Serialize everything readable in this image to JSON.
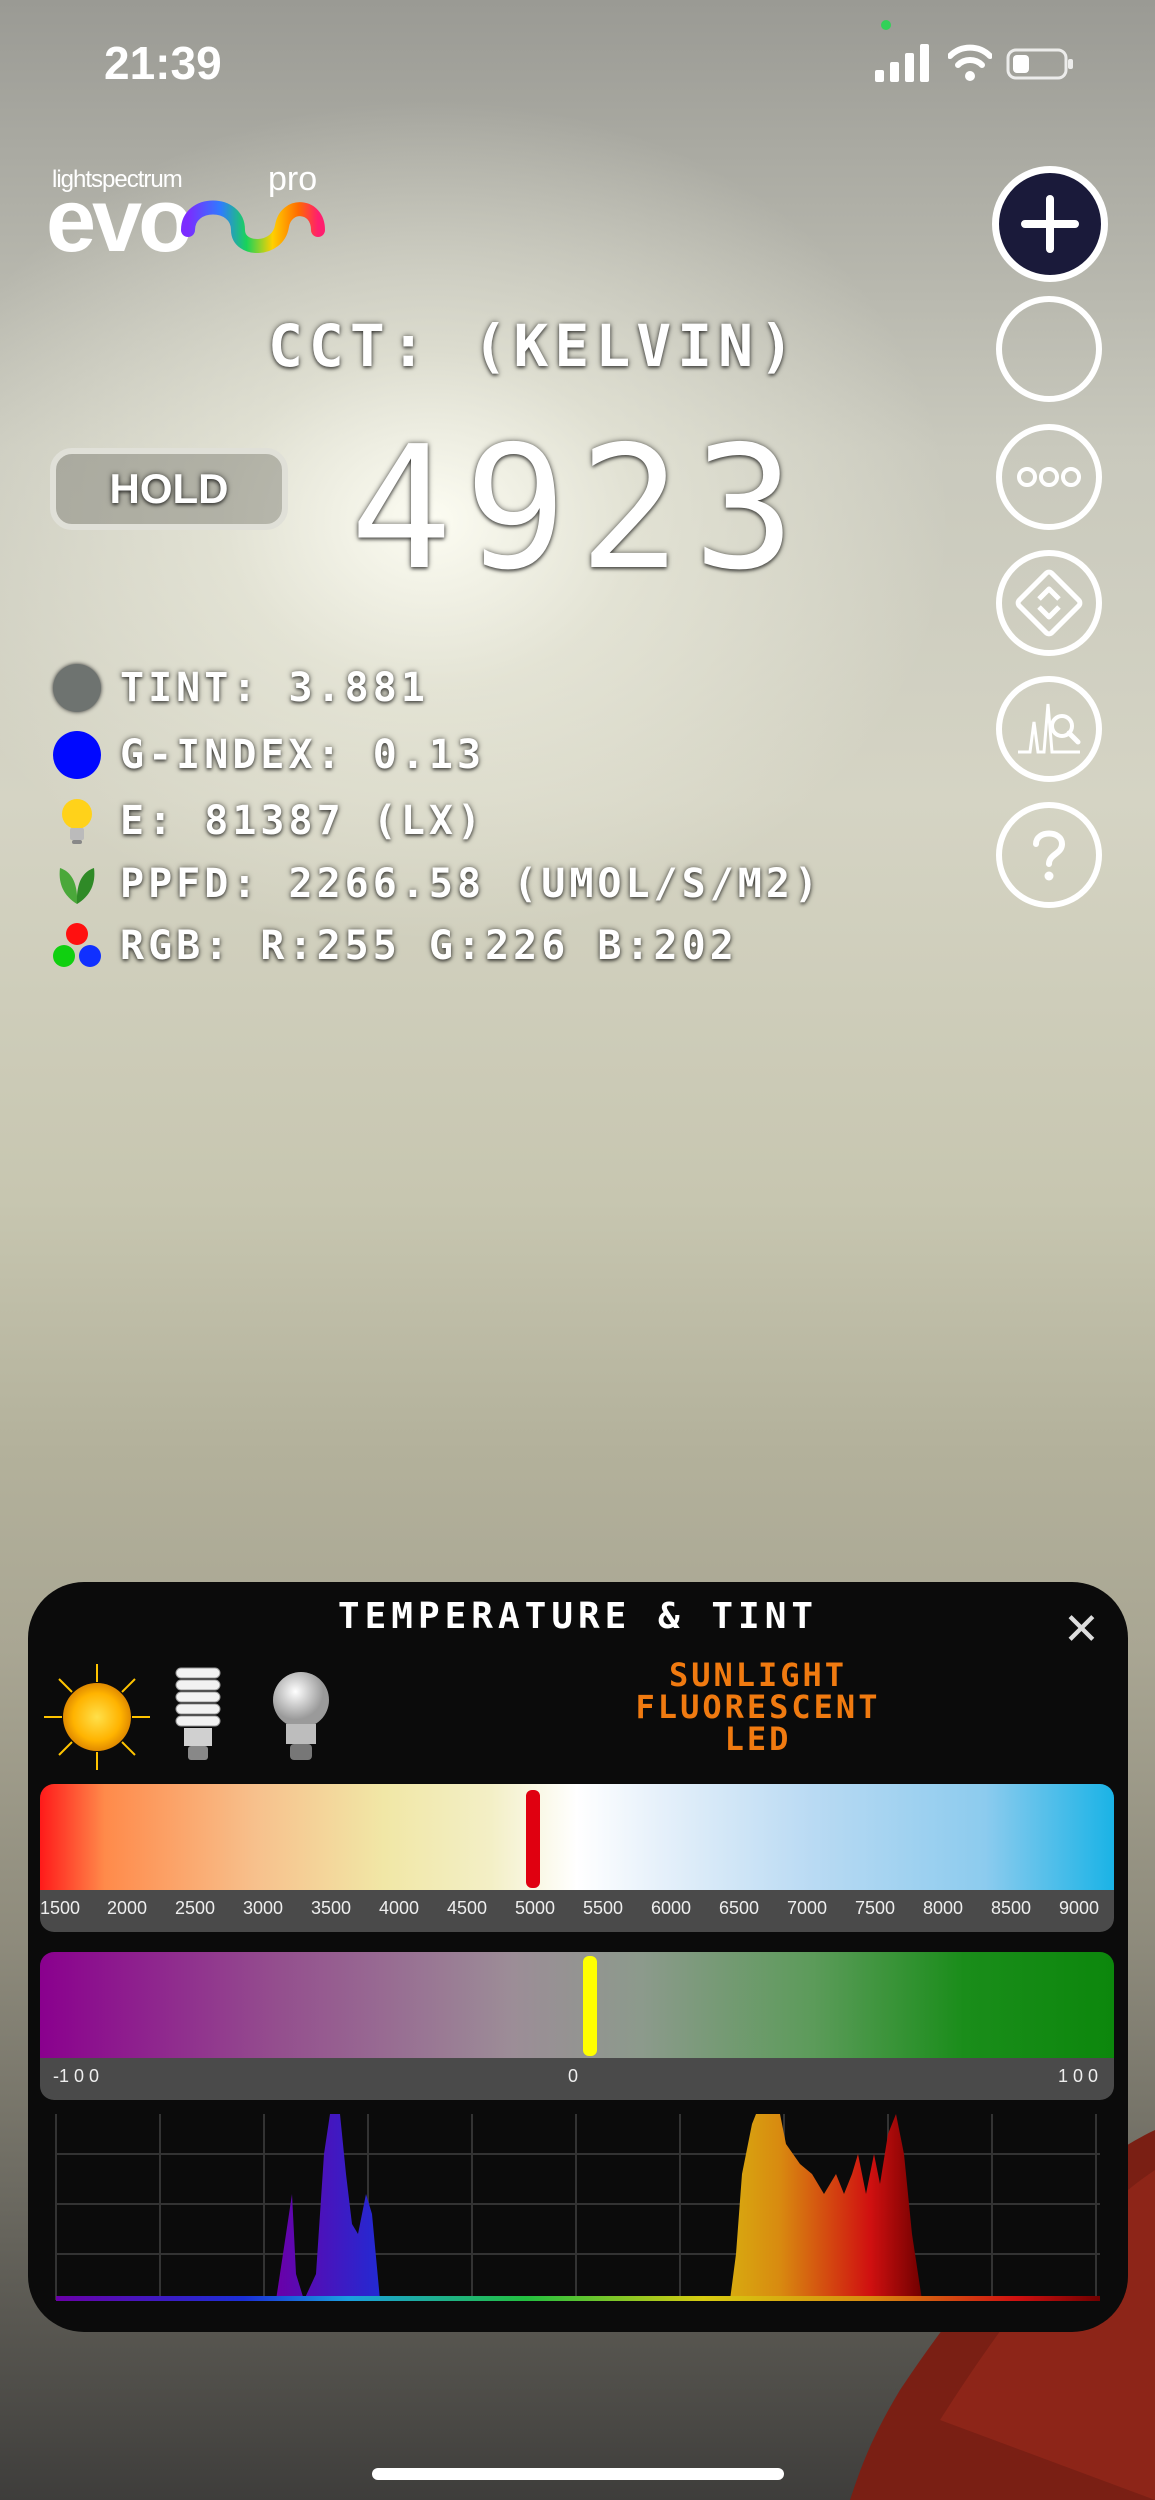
{
  "status_bar": {
    "time": "21:39"
  },
  "logo": {
    "small": "lightspectrum",
    "main": "evo",
    "pro": "pro"
  },
  "title": "CCT: (KELVIN)",
  "hold_label": "HOLD",
  "cct_value": "4923",
  "metrics": [
    {
      "icon": "gray-circle-icon",
      "text": "TINT: 3.881"
    },
    {
      "icon": "blue-circle-icon",
      "text": "G-INDEX: 0.13"
    },
    {
      "icon": "lightbulb-icon",
      "text": "E: 81387 (LX)"
    },
    {
      "icon": "leaf-icon",
      "text": "PPFD: 2266.58 (UMOL/S/M2)"
    },
    {
      "icon": "rgb-dots-icon",
      "text": "RGB: R:255 G:226 B:202"
    }
  ],
  "right_buttons": [
    "add-icon",
    "capture-icon",
    "more-icon",
    "flip-camera-icon",
    "spectrum-search-icon",
    "help-icon"
  ],
  "panel": {
    "title": "TEMPERATURE & TINT",
    "close": "✕",
    "light_types": [
      "SUNLIGHT",
      "FLUORESCENT",
      "LED"
    ],
    "temp_scale": [
      "1500",
      "2000",
      "2500",
      "3000",
      "3500",
      "4000",
      "4500",
      "5000",
      "5500",
      "6000",
      "6500",
      "7000",
      "7500",
      "8000",
      "8500",
      "9000"
    ],
    "temp_value": 4923,
    "tint_scale": [
      "-1 0 0",
      "0",
      "1 0 0"
    ],
    "tint_value": 3.881,
    "colors": {
      "accent": "#f07a10",
      "temp_marker": "#e00010",
      "tint_marker": "#ffff00"
    }
  }
}
